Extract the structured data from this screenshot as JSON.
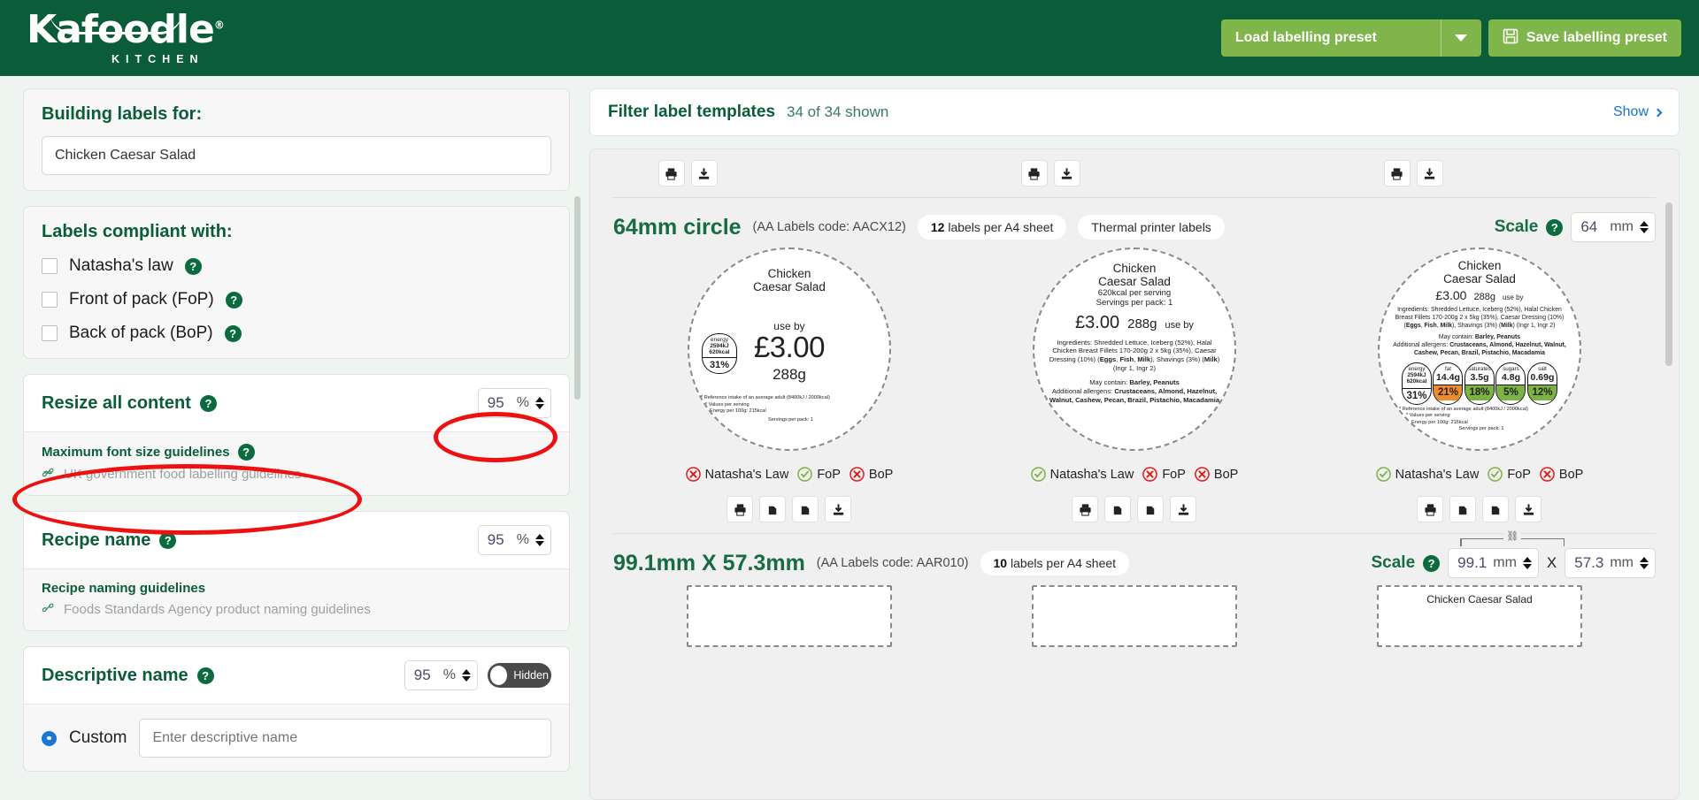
{
  "header": {
    "logo_word": "Kafoodle",
    "logo_sub": "KITCHEN",
    "load_preset_label": "Load labelling preset",
    "save_preset_label": "Save labelling preset"
  },
  "sidebar": {
    "building_labels_title": "Building labels for:",
    "recipe_value": "Chicken Caesar Salad",
    "compliant_title": "Labels compliant with:",
    "compliance_options": [
      {
        "label": "Natasha's law",
        "checked": false
      },
      {
        "label": "Front of pack (FoP)",
        "checked": false
      },
      {
        "label": "Back of pack (BoP)",
        "checked": false
      }
    ],
    "resize_title": "Resize all content",
    "resize_value": "95",
    "resize_unit": "%",
    "max_font_title": "Maximum font size guidelines",
    "max_font_link": "UK government food labelling guidelines",
    "recipe_name_title": "Recipe name",
    "recipe_name_value": "95",
    "recipe_name_unit": "%",
    "recipe_guide_title": "Recipe naming guidelines",
    "recipe_guide_link": "Foods Standards Agency product naming guidelines",
    "descriptive_title": "Descriptive name",
    "descriptive_value": "95",
    "descriptive_unit": "%",
    "descriptive_toggle": "Hidden",
    "custom_label": "Custom",
    "descriptive_placeholder": "Enter descriptive name"
  },
  "filter": {
    "title": "Filter label templates",
    "count": "34 of 34 shown",
    "show_label": "Show"
  },
  "templates": [
    {
      "name": "64mm circle",
      "code": "(AA Labels code: AACX12)",
      "pills": [
        {
          "bold": "12",
          "text": " labels per A4 sheet"
        },
        {
          "bold": "",
          "text": "Thermal printer labels"
        }
      ],
      "scale_label": "Scale",
      "scale_value": "64",
      "scale_unit": "mm"
    },
    {
      "name": "99.1mm X 57.3mm",
      "code": "(AA Labels code: AAR010)",
      "pills": [
        {
          "bold": "10",
          "text": " labels per A4 sheet"
        }
      ],
      "scale_label": "Scale",
      "scale_value": "99.1",
      "scale_unit": "mm",
      "scale_value2": "57.3",
      "scale_unit2": "mm",
      "scale_sep": "X"
    }
  ],
  "labels": [
    {
      "variant": "price-forward",
      "title_line1": "Chicken",
      "title_line2": "Caesar Salad",
      "use_by": "use by",
      "price": "£3.00",
      "weight": "288g",
      "energy": {
        "name": "energy",
        "kj": "2594kJ",
        "kcal": "620kcal",
        "pct": "31%"
      },
      "footnote1": "* Reference intake of an average adult (8400kJ / 2000kcal)",
      "footnote2": "* Values per serving",
      "footnote3": "Energy per 100g: 215kcal",
      "servings": "Servings per pack: 1",
      "compliance": [
        {
          "label": "Natasha's Law",
          "ok": false
        },
        {
          "label": "FoP",
          "ok": true
        },
        {
          "label": "BoP",
          "ok": false
        }
      ]
    },
    {
      "variant": "ingredients",
      "title_line1": "Chicken",
      "title_line2": "Caesar Salad",
      "kcal_line": "620kcal per serving",
      "servings": "Servings per pack: 1",
      "price": "£3.00",
      "weight": "288g",
      "use_by": "use by",
      "ingredients_html": "Ingredients: Shredded Lettuce, Iceberg (52%), Halal Chicken Breast Fillets 170-200g 2 x 5kg (35%), Caesar Dressing (10%) (<b>Eggs</b>, <b>Fish</b>, <b>Milk</b>), Shavings (3%) (<b>Milk</b>) (Ingr 1, Ingr 2)",
      "may_contain_html": "May contain: <b>Barley, Peanuts</b>",
      "additional_html": "Additional allergens: <b>Crustaceans, Almond, Hazelnut, Walnut, Cashew, Pecan, Brazil, Pistachio, Macadamia</b>",
      "compliance": [
        {
          "label": "Natasha's Law",
          "ok": true
        },
        {
          "label": "FoP",
          "ok": false
        },
        {
          "label": "BoP",
          "ok": false
        }
      ]
    },
    {
      "variant": "full",
      "title_line1": "Chicken",
      "title_line2": "Caesar Salad",
      "price": "£3.00",
      "weight": "288g",
      "use_by": "use by",
      "ingredients_html": "Ingredients: Shredded Lettuce, Iceberg (52%), Halal Chicken Breast Fillets 170-200g 2 x 5kg (35%), Caesar Dressing (10%) (<b>Eggs</b>, <b>Fish</b>, <b>Milk</b>), Shavings (3%) (<b>Milk</b>) (Ingr 1, Ingr 2)",
      "may_contain_html": "May contain: <b>Barley, Peanuts</b>",
      "additional_html": "Additional allergens: <b>Crustaceans, Almond, Hazelnut, Walnut, Cashew, Pecan, Brazil, Pistachio, Macadamia</b>",
      "nutrition": [
        {
          "name": "energy",
          "value": "2594kJ 620kcal",
          "pct": "31%",
          "color": "#ffffff",
          "multiline": true
        },
        {
          "name": "fat",
          "value": "14.4g",
          "pct": "21%",
          "color": "#ef8b2c"
        },
        {
          "name": "saturates",
          "value": "3.5g",
          "pct": "18%",
          "color": "#7cb342"
        },
        {
          "name": "sugars",
          "value": "4.8g",
          "pct": "5%",
          "color": "#7cb342"
        },
        {
          "name": "salt",
          "value": "0.69g",
          "pct": "12%",
          "color": "#7cb342"
        }
      ],
      "footnote1": "* Reference intake of an average adult (8400kJ / 2000kcal)",
      "footnote2": "* Values per serving",
      "footnote3": "Energy per 100g: 215kcal",
      "servings": "Servings per pack: 1",
      "compliance": [
        {
          "label": "Natasha's Law",
          "ok": true
        },
        {
          "label": "FoP",
          "ok": true
        },
        {
          "label": "BoP",
          "ok": false
        }
      ]
    }
  ],
  "icons": {
    "print": "print-icon",
    "download": "download-icon",
    "save": "save-icon",
    "help": "?",
    "link": "link-icon"
  },
  "colors": {
    "brand_green": "#0b5c38",
    "accent_green": "#7fb54a",
    "annotation_red": "#ee1111",
    "amber": "#ef8b2c",
    "green_light": "#7cb342"
  }
}
